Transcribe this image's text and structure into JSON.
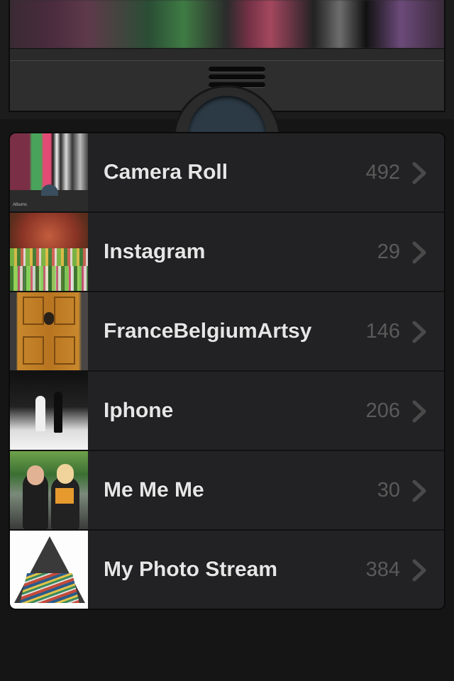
{
  "camera_panel": {
    "handle_icon": "drag-handle-icon",
    "shutter_icon": "shutter-button"
  },
  "albums": [
    {
      "name": "Camera Roll",
      "count": "492",
      "thumb_label": "CAMERA ROLL",
      "thumb_button": "Albums"
    },
    {
      "name": "Instagram",
      "count": "29"
    },
    {
      "name": "FranceBelgiumArtsy",
      "count": "146"
    },
    {
      "name": "Iphone",
      "count": "206"
    },
    {
      "name": "Me Me Me",
      "count": "30"
    },
    {
      "name": "My Photo Stream",
      "count": "384"
    }
  ],
  "colors": {
    "background": "#151515",
    "list_background": "#222224",
    "album_text": "#e6e6e6",
    "count_text": "#5a5a5a"
  }
}
